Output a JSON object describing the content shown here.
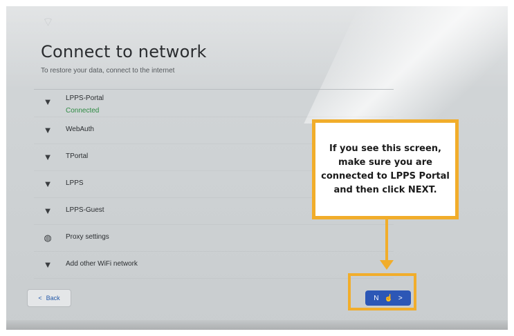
{
  "header": {
    "title": "Connect to network",
    "subtitle": "To restore your data, connect to the internet"
  },
  "networks": [
    {
      "name": "LPPS-Portal",
      "status": "Connected",
      "icon": "wifi-locked-icon"
    },
    {
      "name": "WebAuth",
      "status": "",
      "icon": "wifi-icon"
    },
    {
      "name": "TPortal",
      "status": "",
      "icon": "wifi-locked-icon"
    },
    {
      "name": "LPPS",
      "status": "",
      "icon": "wifi-locked-icon"
    },
    {
      "name": "LPPS-Guest",
      "status": "",
      "icon": "wifi-locked-icon"
    },
    {
      "name": "Proxy settings",
      "status": "",
      "icon": "globe-plus-icon"
    },
    {
      "name": "Add other WiFi network",
      "status": "",
      "icon": "wifi-add-icon"
    }
  ],
  "buttons": {
    "back_label": "Back",
    "next_label": "N"
  },
  "callout": {
    "text": "If you see this screen, make sure you are connected to LPPS Portal and then click NEXT."
  },
  "colors": {
    "accent": "#2c57b6",
    "highlight": "#f1ad2b",
    "connected": "#2e8b43"
  }
}
